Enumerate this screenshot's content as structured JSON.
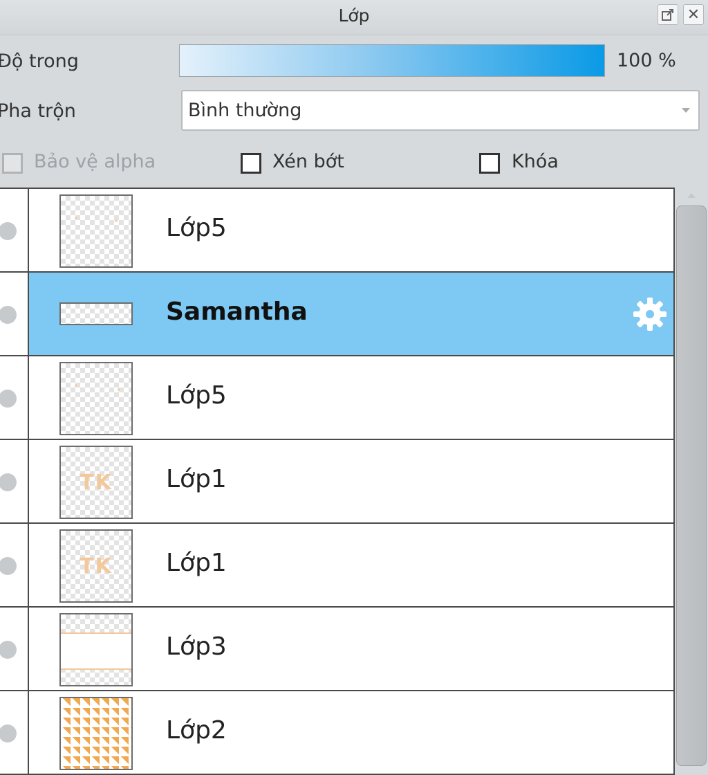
{
  "window": {
    "title": "Lớp",
    "detach_icon": "popout-icon",
    "close_icon": "close-icon"
  },
  "opacity": {
    "label": "Độ trong",
    "value": 100,
    "value_text": "100 %"
  },
  "blend": {
    "label": "Pha trộn",
    "selected": "Bình thường"
  },
  "options": {
    "protect_alpha": {
      "label": "Bảo vệ alpha",
      "checked": false,
      "disabled": true
    },
    "clipping": {
      "label": "Xén bớt",
      "checked": false
    },
    "lock": {
      "label": "Khóa",
      "checked": false
    }
  },
  "layers": [
    {
      "name": "Lớp5",
      "selected": false,
      "thumb": "specks"
    },
    {
      "name": "Samantha",
      "selected": true,
      "thumb": "thin",
      "settings_icon": "gear-icon"
    },
    {
      "name": "Lớp5",
      "selected": false,
      "thumb": "specks"
    },
    {
      "name": "Lớp1",
      "selected": false,
      "thumb": "tk",
      "thumb_text": "TK"
    },
    {
      "name": "Lớp1",
      "selected": false,
      "thumb": "tk",
      "thumb_text": "TK"
    },
    {
      "name": "Lớp3",
      "selected": false,
      "thumb": "band"
    },
    {
      "name": "Lớp2",
      "selected": false,
      "thumb": "stripes"
    }
  ],
  "colors": {
    "selection": "#7dc9f3",
    "opacity_fill_end": "#0a9ae6"
  }
}
